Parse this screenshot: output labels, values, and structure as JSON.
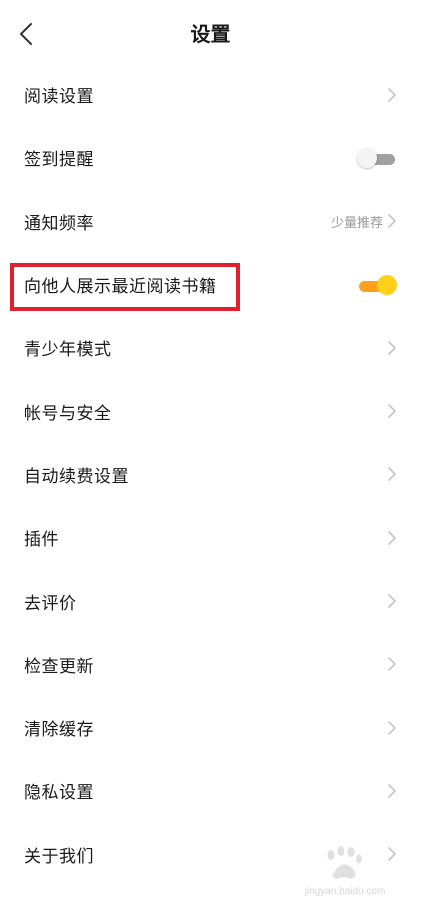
{
  "header": {
    "title": "设置"
  },
  "settings": [
    {
      "label": "阅读设置",
      "type": "link"
    },
    {
      "label": "签到提醒",
      "type": "toggle",
      "state": "off"
    },
    {
      "label": "通知频率",
      "type": "link",
      "value": "少量推荐"
    },
    {
      "label": "向他人展示最近阅读书籍",
      "type": "toggle",
      "state": "on"
    },
    {
      "label": "青少年模式",
      "type": "link"
    },
    {
      "label": "帐号与安全",
      "type": "link"
    },
    {
      "label": "自动续费设置",
      "type": "link"
    },
    {
      "label": "插件",
      "type": "link"
    },
    {
      "label": "去评价",
      "type": "link"
    },
    {
      "label": "检查更新",
      "type": "link"
    },
    {
      "label": "清除缓存",
      "type": "link"
    },
    {
      "label": "隐私设置",
      "type": "link"
    },
    {
      "label": "关于我们",
      "type": "link"
    }
  ],
  "colors": {
    "toggle_on_track": "#ffa21a",
    "toggle_on_knob": "#ffd11a",
    "toggle_off_track": "#a0a0a0",
    "highlight": "#e0202e"
  },
  "icons": {
    "back": "chevron-left-icon",
    "row_arrow": "chevron-right-icon"
  },
  "watermark": {
    "text": "jingyan.baidu.com"
  }
}
